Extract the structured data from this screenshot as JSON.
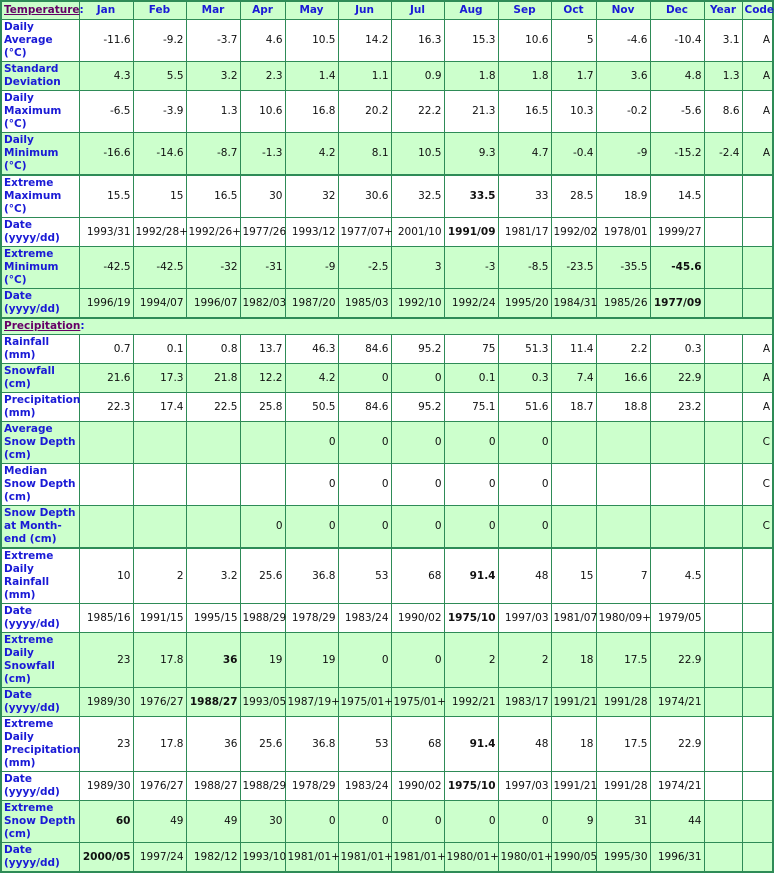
{
  "header": {
    "columns": [
      "Jan",
      "Feb",
      "Mar",
      "Apr",
      "May",
      "Jun",
      "Jul",
      "Aug",
      "Sep",
      "Oct",
      "Nov",
      "Dec",
      "Year",
      "Code"
    ]
  },
  "temperature": {
    "title": "Temperature",
    "rows": [
      {
        "label": "Daily Average (°C)",
        "values": [
          "-11.6",
          "-9.2",
          "-3.7",
          "4.6",
          "10.5",
          "14.2",
          "16.3",
          "15.3",
          "10.6",
          "5",
          "-4.6",
          "-10.4",
          "3.1",
          "A"
        ],
        "bold": []
      },
      {
        "label": "Standard Deviation",
        "values": [
          "4.3",
          "5.5",
          "3.2",
          "2.3",
          "1.4",
          "1.1",
          "0.9",
          "1.8",
          "1.8",
          "1.7",
          "3.6",
          "4.8",
          "1.3",
          "A"
        ],
        "bold": []
      },
      {
        "label": "Daily Maximum (°C)",
        "values": [
          "-6.5",
          "-3.9",
          "1.3",
          "10.6",
          "16.8",
          "20.2",
          "22.2",
          "21.3",
          "16.5",
          "10.3",
          "-0.2",
          "-5.6",
          "8.6",
          "A"
        ],
        "bold": []
      },
      {
        "label": "Daily Minimum (°C)",
        "values": [
          "-16.6",
          "-14.6",
          "-8.7",
          "-1.3",
          "4.2",
          "8.1",
          "10.5",
          "9.3",
          "4.7",
          "-0.4",
          "-9",
          "-15.2",
          "-2.4",
          "A"
        ],
        "bold": []
      },
      {
        "label": "Extreme Maximum (°C)",
        "values": [
          "15.5",
          "15",
          "16.5",
          "30",
          "32",
          "30.6",
          "32.5",
          "33.5",
          "33",
          "28.5",
          "18.9",
          "14.5",
          "",
          ""
        ],
        "bold": [
          7
        ]
      },
      {
        "label": "Date (yyyy/dd)",
        "values": [
          "1993/31",
          "1992/28+",
          "1992/26+",
          "1977/26",
          "1993/12",
          "1977/07+",
          "2001/10",
          "1991/09",
          "1981/17",
          "1992/02",
          "1978/01",
          "1999/27",
          "",
          ""
        ],
        "bold": [
          7
        ]
      },
      {
        "label": "Extreme Minimum (°C)",
        "values": [
          "-42.5",
          "-42.5",
          "-32",
          "-31",
          "-9",
          "-2.5",
          "3",
          "-3",
          "-8.5",
          "-23.5",
          "-35.5",
          "-45.6",
          "",
          ""
        ],
        "bold": [
          11
        ]
      },
      {
        "label": "Date (yyyy/dd)",
        "values": [
          "1996/19",
          "1994/07",
          "1996/07",
          "1982/03",
          "1987/20",
          "1985/03",
          "1992/10",
          "1992/24",
          "1995/20",
          "1984/31",
          "1985/26",
          "1977/09",
          "",
          ""
        ],
        "bold": [
          11
        ]
      }
    ]
  },
  "precipitation": {
    "title": "Precipitation",
    "rows": [
      {
        "label": "Rainfall (mm)",
        "values": [
          "0.7",
          "0.1",
          "0.8",
          "13.7",
          "46.3",
          "84.6",
          "95.2",
          "75",
          "51.3",
          "11.4",
          "2.2",
          "0.3",
          "",
          "A"
        ],
        "bold": []
      },
      {
        "label": "Snowfall (cm)",
        "values": [
          "21.6",
          "17.3",
          "21.8",
          "12.2",
          "4.2",
          "0",
          "0",
          "0.1",
          "0.3",
          "7.4",
          "16.6",
          "22.9",
          "",
          "A"
        ],
        "bold": []
      },
      {
        "label": "Precipitation (mm)",
        "values": [
          "22.3",
          "17.4",
          "22.5",
          "25.8",
          "50.5",
          "84.6",
          "95.2",
          "75.1",
          "51.6",
          "18.7",
          "18.8",
          "23.2",
          "",
          "A"
        ],
        "bold": []
      },
      {
        "label": "Average Snow Depth (cm)",
        "values": [
          "",
          "",
          "",
          "",
          "0",
          "0",
          "0",
          "0",
          "0",
          "",
          "",
          "",
          "",
          "C"
        ],
        "bold": []
      },
      {
        "label": "Median Snow Depth (cm)",
        "values": [
          "",
          "",
          "",
          "",
          "0",
          "0",
          "0",
          "0",
          "0",
          "",
          "",
          "",
          "",
          "C"
        ],
        "bold": []
      },
      {
        "label": "Snow Depth at Month-end (cm)",
        "values": [
          "",
          "",
          "",
          "0",
          "0",
          "0",
          "0",
          "0",
          "0",
          "",
          "",
          "",
          "",
          "C"
        ],
        "bold": []
      },
      {
        "label": "Extreme Daily Rainfall (mm)",
        "values": [
          "10",
          "2",
          "3.2",
          "25.6",
          "36.8",
          "53",
          "68",
          "91.4",
          "48",
          "15",
          "7",
          "4.5",
          "",
          ""
        ],
        "bold": [
          7
        ]
      },
      {
        "label": "Date (yyyy/dd)",
        "values": [
          "1985/16",
          "1991/15",
          "1995/15",
          "1988/29",
          "1978/29",
          "1983/24",
          "1990/02",
          "1975/10",
          "1997/03",
          "1981/07",
          "1980/09+",
          "1979/05",
          "",
          ""
        ],
        "bold": [
          7
        ]
      },
      {
        "label": "Extreme Daily Snowfall (cm)",
        "values": [
          "23",
          "17.8",
          "36",
          "19",
          "19",
          "0",
          "0",
          "2",
          "2",
          "18",
          "17.5",
          "22.9",
          "",
          ""
        ],
        "bold": [
          2
        ]
      },
      {
        "label": "Date (yyyy/dd)",
        "values": [
          "1989/30",
          "1976/27",
          "1988/27",
          "1993/05",
          "1987/19+",
          "1975/01+",
          "1975/01+",
          "1992/21",
          "1983/17",
          "1991/21",
          "1991/28",
          "1974/21",
          "",
          ""
        ],
        "bold": [
          2
        ]
      },
      {
        "label": "Extreme Daily Precipitation (mm)",
        "values": [
          "23",
          "17.8",
          "36",
          "25.6",
          "36.8",
          "53",
          "68",
          "91.4",
          "48",
          "18",
          "17.5",
          "22.9",
          "",
          ""
        ],
        "bold": [
          7
        ]
      },
      {
        "label": "Date (yyyy/dd)",
        "values": [
          "1989/30",
          "1976/27",
          "1988/27",
          "1988/29",
          "1978/29",
          "1983/24",
          "1990/02",
          "1975/10",
          "1997/03",
          "1991/21",
          "1991/28",
          "1974/21",
          "",
          ""
        ],
        "bold": [
          7
        ]
      },
      {
        "label": "Extreme Snow Depth (cm)",
        "values": [
          "60",
          "49",
          "49",
          "30",
          "0",
          "0",
          "0",
          "0",
          "0",
          "9",
          "31",
          "44",
          "",
          ""
        ],
        "bold": [
          0
        ]
      },
      {
        "label": "Date (yyyy/dd)",
        "values": [
          "2000/05",
          "1997/24",
          "1982/12",
          "1993/10",
          "1981/01+",
          "1981/01+",
          "1981/01+",
          "1980/01+",
          "1980/01+",
          "1990/05",
          "1995/30",
          "1996/31",
          "",
          ""
        ],
        "bold": [
          0
        ]
      }
    ]
  }
}
